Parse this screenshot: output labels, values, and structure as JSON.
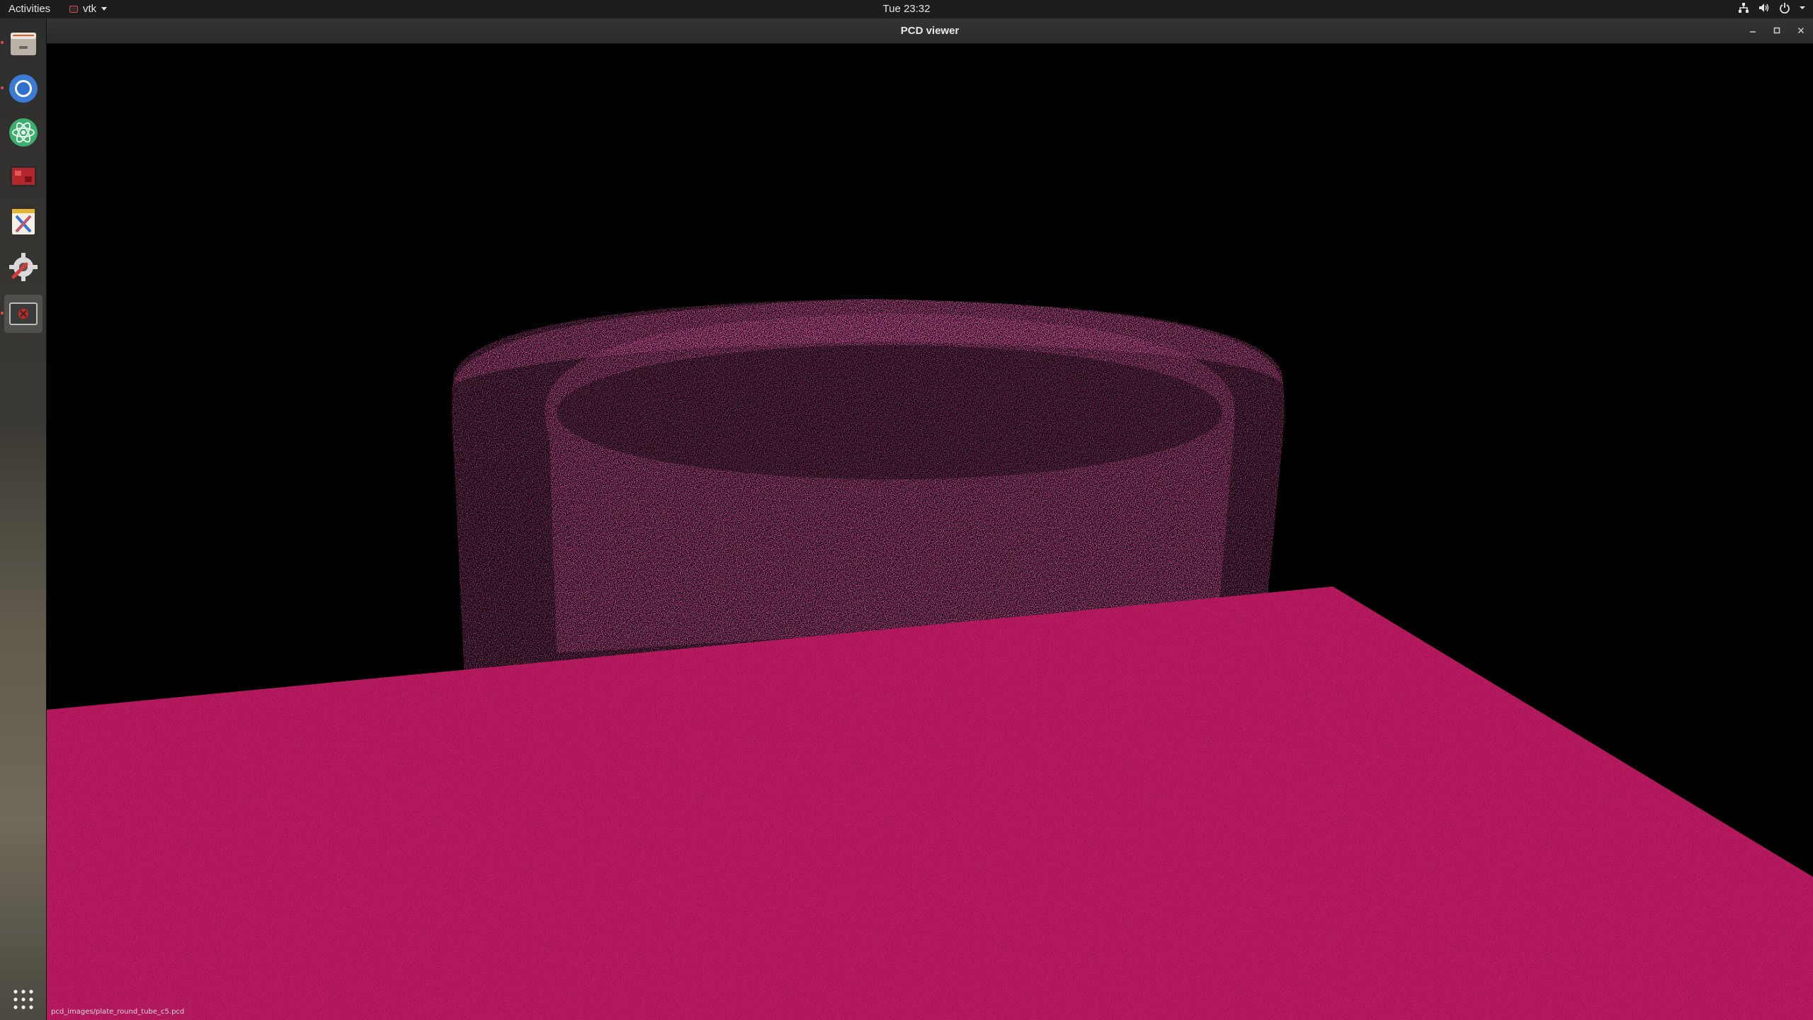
{
  "topbar": {
    "activities": "Activities",
    "app_menu": "vtk",
    "clock": "Tue 23:32",
    "tray_icons": [
      "network-icon",
      "volume-icon",
      "power-icon",
      "chevron-down-icon"
    ]
  },
  "dock": {
    "items": [
      {
        "name": "files-icon"
      },
      {
        "name": "chromium-icon"
      },
      {
        "name": "atom-icon"
      },
      {
        "name": "video-icon"
      },
      {
        "name": "text-editor-icon"
      },
      {
        "name": "settings-icon"
      },
      {
        "name": "vtk-window-icon"
      }
    ],
    "apps_grid_icon": "show-applications-icon"
  },
  "window": {
    "title": "PCD viewer",
    "controls": [
      "minimize-icon",
      "maximize-icon",
      "close-icon"
    ],
    "status_file": "pcd_images/plate_round_tube_c5.pcd"
  },
  "colors": {
    "point_cloud": "#b81b5f",
    "background": "#000000",
    "topbar": "#1d1d1d",
    "titlebar": "#2e2e2e"
  }
}
